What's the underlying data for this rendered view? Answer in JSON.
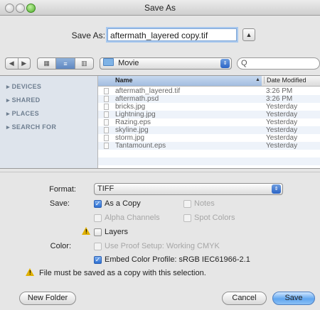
{
  "window": {
    "title": "Save As"
  },
  "save_as": {
    "label": "Save As:",
    "value": "aftermath_layered copy.tif"
  },
  "toolbar": {
    "back_label": "◀",
    "forward_label": "▶",
    "view_icons": "▦",
    "view_list": "≡",
    "view_columns": "▥",
    "location": "Movie",
    "search_placeholder": "Q"
  },
  "sidebar": {
    "items": [
      {
        "label": "DEVICES"
      },
      {
        "label": "SHARED"
      },
      {
        "label": "PLACES"
      },
      {
        "label": "SEARCH FOR"
      }
    ]
  },
  "list": {
    "columns": {
      "name": "Name",
      "date": "Date Modified"
    },
    "rows": [
      {
        "name": "aftermath_layered.tif",
        "date": "3:26 PM"
      },
      {
        "name": "aftermath.psd",
        "date": "3:26 PM"
      },
      {
        "name": "bricks.jpg",
        "date": "Yesterday"
      },
      {
        "name": "Lightning.jpg",
        "date": "Yesterday"
      },
      {
        "name": "Razing.eps",
        "date": "Yesterday"
      },
      {
        "name": "skyline.jpg",
        "date": "Yesterday"
      },
      {
        "name": "storm.jpg",
        "date": "Yesterday"
      },
      {
        "name": "Tantamount.eps",
        "date": "Yesterday"
      }
    ]
  },
  "options": {
    "format_label": "Format:",
    "format_value": "TIFF",
    "save_label": "Save:",
    "as_a_copy": "As a Copy",
    "notes": "Notes",
    "alpha_channels": "Alpha Channels",
    "spot_colors": "Spot Colors",
    "layers": "Layers",
    "color_label": "Color:",
    "use_proof_setup": "Use Proof Setup:  Working CMYK",
    "embed_color_profile": "Embed Color Profile:  sRGB IEC61966-2.1",
    "warning_message": "File must be saved as a copy with this selection."
  },
  "buttons": {
    "new_folder": "New Folder",
    "cancel": "Cancel",
    "save": "Save"
  },
  "colors": {
    "accent": "#3d7fd8",
    "warning": "#e0b000",
    "sidebar_bg": "#dee4ec"
  }
}
